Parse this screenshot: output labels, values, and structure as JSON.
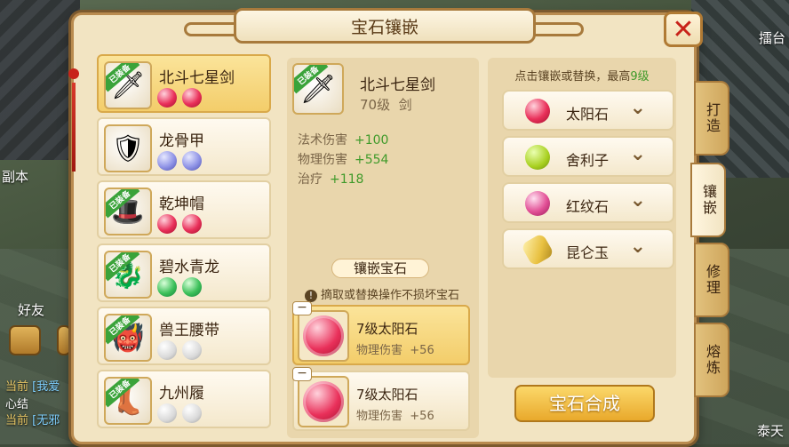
{
  "window": {
    "title": "宝石镶嵌",
    "close_label": "✕"
  },
  "scene": {
    "left_label": "副本",
    "right_top_label": "擂台",
    "friends_label": "好友",
    "bottom_right_label": "泰天"
  },
  "chat": [
    {
      "tag": "当前",
      "who": "[我爱",
      "text": ""
    },
    {
      "tag": "",
      "who": "",
      "text": "心结"
    },
    {
      "tag": "当前",
      "who": "[无邪",
      "text": ""
    }
  ],
  "equipment_list": [
    {
      "name": "北斗七星剑",
      "equipped": "已装备",
      "gems": [
        "sun",
        "sun"
      ],
      "icon": "sword-icon",
      "glyph": "🗡",
      "selected": true
    },
    {
      "name": "龙骨甲",
      "equipped": "",
      "gems": [
        "moon",
        "moon"
      ],
      "icon": "armor-icon",
      "glyph": "🛡",
      "selected": false
    },
    {
      "name": "乾坤帽",
      "equipped": "已装备",
      "gems": [
        "sun",
        "sun"
      ],
      "icon": "hat-icon",
      "glyph": "🎩",
      "selected": false
    },
    {
      "name": "碧水青龙",
      "equipped": "已装备",
      "gems": [
        "green",
        "green"
      ],
      "icon": "dragon-ring-icon",
      "glyph": "🐉",
      "selected": false
    },
    {
      "name": "兽王腰带",
      "equipped": "已装备",
      "gems": [
        "empty",
        "empty"
      ],
      "icon": "belt-icon",
      "glyph": "👹",
      "selected": false
    },
    {
      "name": "九州履",
      "equipped": "已装备",
      "gems": [
        "empty",
        "empty"
      ],
      "icon": "boots-icon",
      "glyph": "👢",
      "selected": false
    }
  ],
  "selected_item": {
    "equipped": "已装备",
    "name": "北斗七星剑",
    "level": "70级",
    "type": "剑",
    "stats": [
      {
        "label": "法术伤害",
        "value": "+100"
      },
      {
        "label": "物理伤害",
        "value": "+554"
      },
      {
        "label": "治疗",
        "value": "+118"
      }
    ]
  },
  "inlay": {
    "title": "镶嵌宝石",
    "note_icon": "!",
    "note": "摘取或替换操作不损坏宝石",
    "slots": [
      {
        "name": "7级太阳石",
        "effect": "物理伤害",
        "value": "+56",
        "selected": true,
        "minus": "−"
      },
      {
        "name": "7级太阳石",
        "effect": "物理伤害",
        "value": "+56",
        "selected": false,
        "minus": "−"
      }
    ]
  },
  "gem_panel": {
    "hint_prefix": "点击镶嵌或替换，最高",
    "hint_level": "9级",
    "gems": [
      {
        "name": "太阳石",
        "kind": "sun",
        "icon": "sun-stone-icon"
      },
      {
        "name": "舍利子",
        "kind": "sarira",
        "icon": "sarira-icon"
      },
      {
        "name": "红纹石",
        "kind": "red",
        "icon": "red-stone-icon"
      },
      {
        "name": "昆仑玉",
        "kind": "jade",
        "icon": "kunlun-jade-icon"
      }
    ],
    "chevron": "⌄",
    "compose_label": "宝石合成"
  },
  "tabs": [
    {
      "label": "打造",
      "active": false
    },
    {
      "label": "镶嵌",
      "active": true
    },
    {
      "label": "修理",
      "active": false
    },
    {
      "label": "熔炼",
      "active": false
    }
  ]
}
